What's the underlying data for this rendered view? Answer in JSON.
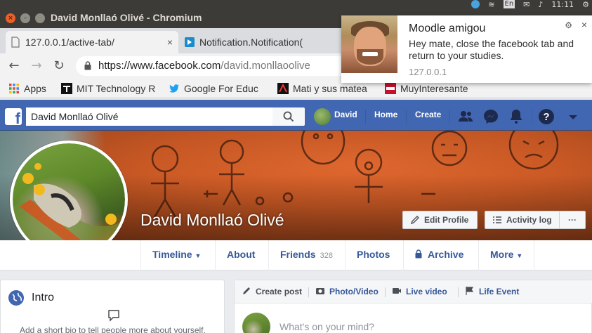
{
  "window": {
    "title": "David Monllaó Olivé - Chromium",
    "tray": [
      "En",
      "11:11"
    ]
  },
  "tabs": [
    {
      "label": "127.0.0.1/active-tab/",
      "close": "×"
    },
    {
      "label": "Notification.Notification(",
      "close": "×"
    }
  ],
  "omnibox": {
    "url_host": "https://www.facebook.com",
    "url_path": "/david.monllaoolive"
  },
  "bookmarks": [
    {
      "label": "Apps"
    },
    {
      "label": "MIT Technology R"
    },
    {
      "label": "Google For Educ"
    },
    {
      "label": "Mati y sus matea"
    },
    {
      "label": "MuyInteresante"
    }
  ],
  "notification": {
    "title": "Moodle amigou",
    "body": "Hey mate, close the facebook tab and return to your studies.",
    "origin": "127.0.0.1",
    "close": "×",
    "gear": "⚙"
  },
  "fb": {
    "search_value": "David Monllaó Olivé",
    "user": "David",
    "nav_home": "Home",
    "nav_create": "Create",
    "brand_color": "#4267b2"
  },
  "profile": {
    "name": "David Monllaó Olivé",
    "edit_profile": "Edit Profile",
    "activity_log": "Activity log",
    "more_dots": "···"
  },
  "profile_nav": {
    "timeline": "Timeline",
    "about": "About",
    "friends": "Friends",
    "friends_count": "328",
    "photos": "Photos",
    "archive": "Archive",
    "more": "More"
  },
  "intro": {
    "title": "Intro",
    "bio_prompt": "Add a short bio to tell people more about yourself."
  },
  "composer": {
    "create_post": "Create post",
    "photo_video": "Photo/Video",
    "live_video": "Live video",
    "life_event": "Life Event",
    "placeholder": "What's on your mind?"
  }
}
